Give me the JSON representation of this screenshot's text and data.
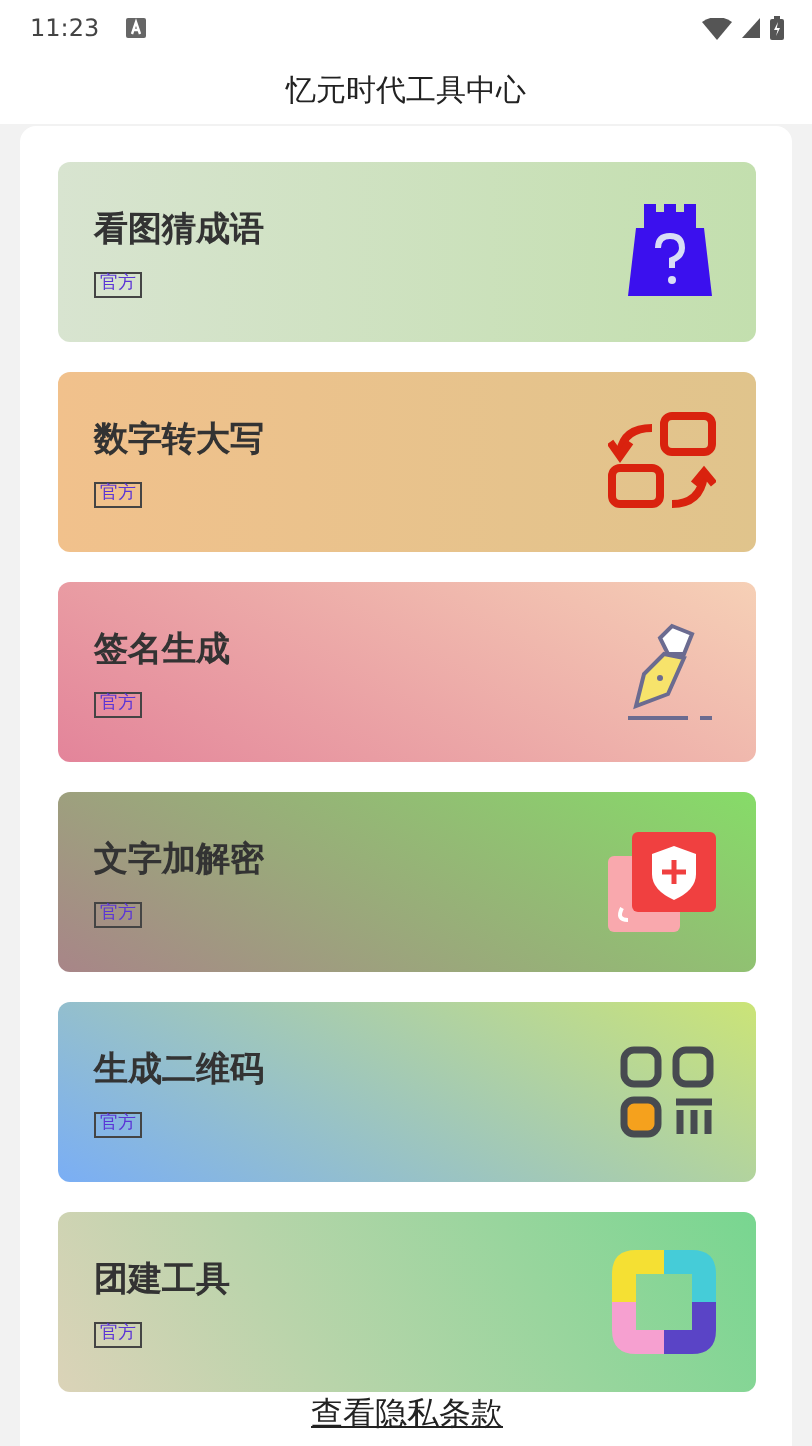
{
  "status_bar": {
    "time": "11:23"
  },
  "header": {
    "title": "忆元时代工具中心"
  },
  "tools": [
    {
      "name": "看图猜成语",
      "badge": "官方"
    },
    {
      "name": "数字转大写",
      "badge": "官方"
    },
    {
      "name": "签名生成",
      "badge": "官方"
    },
    {
      "name": "文字加解密",
      "badge": "官方"
    },
    {
      "name": "生成二维码",
      "badge": "官方"
    },
    {
      "name": "团建工具",
      "badge": "官方"
    }
  ],
  "privacy_link": "查看隐私条款"
}
